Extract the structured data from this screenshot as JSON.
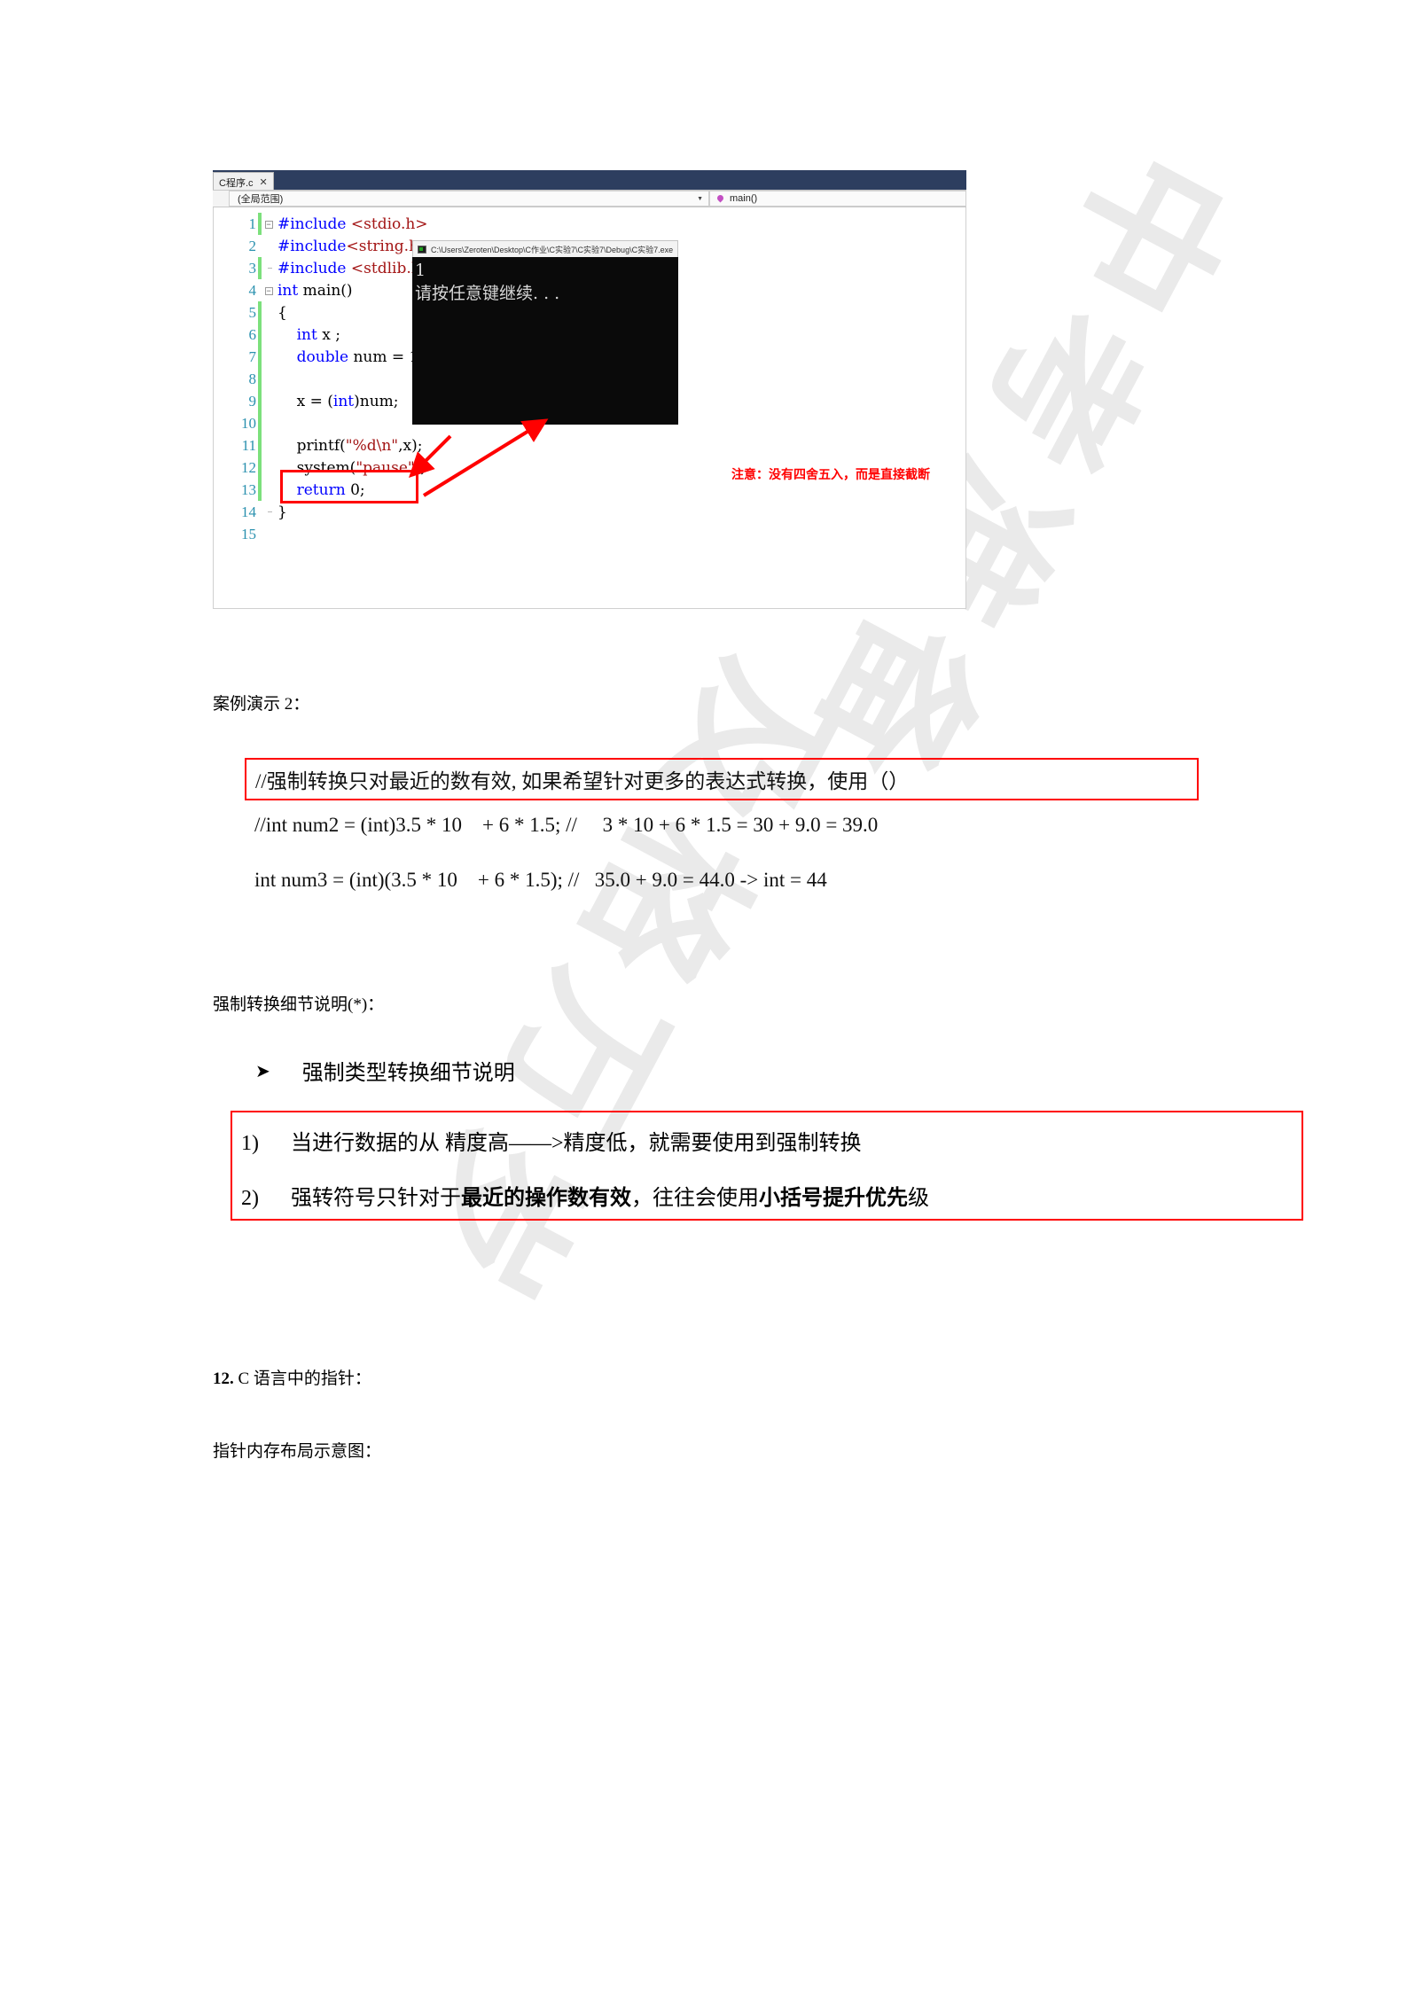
{
  "ide": {
    "tab": {
      "title": "C程序.c",
      "close": "✕"
    },
    "navbar": {
      "scope": "(全局范围)",
      "caret": "▼",
      "member": "main()"
    },
    "code_lines": [
      {
        "n": "1",
        "fold": "minus",
        "changed": true,
        "segments": [
          {
            "t": "#include ",
            "c": "pp"
          },
          {
            "t": "<stdio.h>",
            "c": "inc"
          }
        ]
      },
      {
        "n": "2",
        "fold": "line",
        "changed": false,
        "segments": [
          {
            "t": "#include",
            "c": "pp"
          },
          {
            "t": "<string.h>",
            "c": "inc"
          }
        ]
      },
      {
        "n": "3",
        "fold": "hook",
        "changed": true,
        "segments": [
          {
            "t": "#include ",
            "c": "pp"
          },
          {
            "t": "<stdlib.h>",
            "c": "inc"
          }
        ]
      },
      {
        "n": "4",
        "fold": "minus",
        "changed": false,
        "segments": [
          {
            "t": "int",
            "c": "kw"
          },
          {
            "t": " main()",
            "c": "plain"
          }
        ]
      },
      {
        "n": "5",
        "fold": "line",
        "changed": true,
        "segments": [
          {
            "t": "{",
            "c": "plain"
          }
        ]
      },
      {
        "n": "6",
        "fold": "line",
        "changed": true,
        "segments": [
          {
            "t": "    ",
            "c": "plain"
          },
          {
            "t": "int",
            "c": "kw"
          },
          {
            "t": " x ;",
            "c": "plain"
          }
        ]
      },
      {
        "n": "7",
        "fold": "line",
        "changed": true,
        "segments": [
          {
            "t": "    ",
            "c": "plain"
          },
          {
            "t": "double",
            "c": "kw"
          },
          {
            "t": " num = 1.9625;",
            "c": "plain"
          }
        ]
      },
      {
        "n": "8",
        "fold": "line",
        "changed": true,
        "segments": [
          {
            "t": "",
            "c": "plain"
          }
        ]
      },
      {
        "n": "9",
        "fold": "line",
        "changed": true,
        "segments": [
          {
            "t": "    x = (",
            "c": "plain"
          },
          {
            "t": "int",
            "c": "kw"
          },
          {
            "t": ")num;",
            "c": "plain"
          }
        ]
      },
      {
        "n": "10",
        "fold": "line",
        "changed": true,
        "segments": [
          {
            "t": "",
            "c": "plain"
          }
        ]
      },
      {
        "n": "11",
        "fold": "line",
        "changed": true,
        "segments": [
          {
            "t": "    printf(",
            "c": "plain"
          },
          {
            "t": "\"%d\\n\"",
            "c": "str"
          },
          {
            "t": ",x);",
            "c": "plain"
          }
        ]
      },
      {
        "n": "12",
        "fold": "line",
        "changed": true,
        "segments": [
          {
            "t": "    system(",
            "c": "plain"
          },
          {
            "t": "\"pause\"",
            "c": "str"
          },
          {
            "t": ");",
            "c": "plain"
          }
        ]
      },
      {
        "n": "13",
        "fold": "line",
        "changed": true,
        "segments": [
          {
            "t": "    ",
            "c": "plain"
          },
          {
            "t": "return",
            "c": "kw"
          },
          {
            "t": " 0;",
            "c": "plain"
          }
        ]
      },
      {
        "n": "14",
        "fold": "endhook",
        "changed": false,
        "segments": [
          {
            "t": "}",
            "c": "plain"
          }
        ]
      },
      {
        "n": "15",
        "fold": "none",
        "changed": false,
        "segments": [
          {
            "t": "",
            "c": "plain"
          }
        ]
      }
    ],
    "annotation": "注意：没有四舍五入，而是直接截断",
    "console": {
      "title": "C:\\Users\\Zeroten\\Desktop\\C作业\\C实验7\\C实验7\\Debug\\C实验7.exe",
      "output": "1\n请按任意键继续. . ."
    },
    "highlight_color": "#ff0000",
    "changebar_color": "#7ce07c",
    "keyword_color": "#0000ff",
    "string_color": "#a31515",
    "linenumber_color": "#2b91af"
  },
  "doc": {
    "case2_label": "案例演示 2：",
    "boxed_comment": "//强制转换只对最近的数有效, 如果希望针对更多的表达式转换，使用（）",
    "note_num2": "//int num2 = (int)3.5 * 10    + 6 * 1.5; //     3 * 10 + 6 * 1.5 = 30 + 9.0 = 39.0",
    "note_num3": "int num3 = (int)(3.5 * 10    + 6 * 1.5); //   35.0 + 9.0 = 44.0 -> int = 44",
    "detail_label": "强制转换细节说明(*)：",
    "bullet_marker": "➤",
    "bullet_text": "强制类型转换细节说明",
    "numbered": [
      {
        "index": "1)",
        "parts": [
          {
            "t": "当进行数据的从  精度高——>精度低，就需要使用到强制转换",
            "b": false
          }
        ]
      },
      {
        "index": "2)",
        "parts": [
          {
            "t": "强转符号只针对于",
            "b": false
          },
          {
            "t": "最近的操作数有效",
            "b": true
          },
          {
            "t": "，往往会使用",
            "b": false
          },
          {
            "t": "小括号提升优先",
            "b": true
          },
          {
            "t": "级",
            "b": false
          }
        ]
      }
    ],
    "section12_num": "12.",
    "section12_text": " C 语言中的指针：",
    "pointer_label": "指针内存布局示意图：",
    "box_color": "#ff0000"
  },
  "watermark": {
    "line_a": "中考准备",
    "line_b": "及格万岁"
  }
}
